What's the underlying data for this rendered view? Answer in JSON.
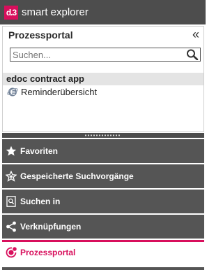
{
  "app": {
    "logo_text": "d.3",
    "title": "smart explorer"
  },
  "panel": {
    "title": "Prozessportal",
    "collapse_glyph": "«",
    "search": {
      "placeholder": "Suchen...",
      "value": ""
    },
    "group_label": "edoc contract app",
    "items": [
      {
        "label": "Reminderübersicht",
        "icon": "browser-e-icon"
      }
    ]
  },
  "nav": {
    "items": [
      {
        "label": "Favoriten",
        "icon": "star-icon"
      },
      {
        "label": "Gespeicherte Suchvorgänge",
        "icon": "star-outline-icon"
      },
      {
        "label": "Suchen in",
        "icon": "search-document-icon"
      },
      {
        "label": "Verknüpfungen",
        "icon": "share-icon"
      },
      {
        "label": "Prozessportal",
        "icon": "process-portal-icon",
        "active": true
      }
    ]
  },
  "colors": {
    "brand": "#d80f5c",
    "dark": "#4d4d4d",
    "nav_bg": "#555555"
  }
}
